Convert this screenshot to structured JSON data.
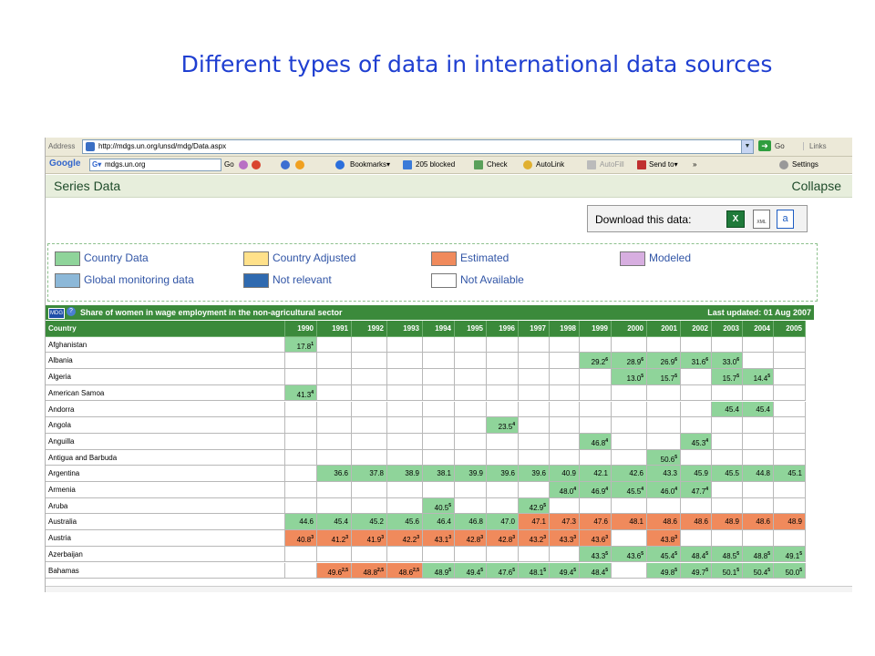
{
  "slide": {
    "title": "Different types of data in international data sources"
  },
  "browser": {
    "address_label": "Address",
    "url": "http://mdgs.un.org/unsd/mdg/Data.aspx",
    "go_label": "Go",
    "links_label": "Links",
    "toolbar": {
      "search_value": "mdgs.un.org",
      "go_label": "Go",
      "bookmarks_label": "Bookmarks▾",
      "blocked_label": "205 blocked",
      "check_label": "Check",
      "autolink_label": "AutoLink",
      "autofill_label": "AutoFill",
      "sendto_label": "Send to▾",
      "more_label": "»",
      "settings_label": "Settings"
    }
  },
  "page": {
    "series_label": "Series Data",
    "collapse_label": "Collapse",
    "download_label": "Download this data:",
    "legend": [
      {
        "label": "Country Data",
        "color": "#8fd49a"
      },
      {
        "label": "Country Adjusted",
        "color": "#ffe18a"
      },
      {
        "label": "Estimated",
        "color": "#f08a5c"
      },
      {
        "label": "Modeled",
        "color": "#d7aee0"
      },
      {
        "label": "Global monitoring data",
        "color": "#8cb8d8"
      },
      {
        "label": "Not relevant",
        "color": "#2f6ab0"
      },
      {
        "label": "Not Available",
        "color": "#ffffff"
      }
    ],
    "table_title": "Share of women in wage employment in the non-agricultural sector",
    "last_updated": "Last updated: 01 Aug 2007",
    "colors": {
      "green": "#8fd49a",
      "orange": "#f08a5c",
      "white": "#ffffff"
    }
  },
  "table": {
    "country_header": "Country",
    "years": [
      "1990",
      "1991",
      "1992",
      "1993",
      "1994",
      "1995",
      "1996",
      "1997",
      "1998",
      "1999",
      "2000",
      "2001",
      "2002",
      "2003",
      "2004",
      "2005"
    ],
    "rows": [
      {
        "country": "Afghanistan",
        "cells": [
          {
            "y": "1990",
            "v": "17.8",
            "fn": "1",
            "c": "g"
          }
        ]
      },
      {
        "country": "Albania",
        "cells": [
          {
            "y": "1999",
            "v": "29.2",
            "fn": "6",
            "c": "g"
          },
          {
            "y": "2000",
            "v": "28.9",
            "fn": "6",
            "c": "g"
          },
          {
            "y": "2001",
            "v": "26.9",
            "fn": "6",
            "c": "g"
          },
          {
            "y": "2002",
            "v": "31.6",
            "fn": "6",
            "c": "g"
          },
          {
            "y": "2003",
            "v": "33.0",
            "fn": "6",
            "c": "g"
          }
        ]
      },
      {
        "country": "Algeria",
        "cells": [
          {
            "y": "2000",
            "v": "13.0",
            "fn": "5",
            "c": "g"
          },
          {
            "y": "2001",
            "v": "15.7",
            "fn": "5",
            "c": "g"
          },
          {
            "y": "2003",
            "v": "15.7",
            "fn": "5",
            "c": "g"
          },
          {
            "y": "2004",
            "v": "14.4",
            "fn": "5",
            "c": "g"
          }
        ]
      },
      {
        "country": "American Samoa",
        "cells": [
          {
            "y": "1990",
            "v": "41.3",
            "fn": "4",
            "c": "g"
          }
        ]
      },
      {
        "country": "Andorra",
        "cells": [
          {
            "y": "2003",
            "v": "45.4",
            "fn": "",
            "c": "g"
          },
          {
            "y": "2004",
            "v": "45.4",
            "fn": "",
            "c": "g"
          }
        ]
      },
      {
        "country": "Angola",
        "cells": [
          {
            "y": "1996",
            "v": "23.5",
            "fn": "4",
            "c": "g"
          }
        ]
      },
      {
        "country": "Anguilla",
        "cells": [
          {
            "y": "1999",
            "v": "46.8",
            "fn": "4",
            "c": "g"
          },
          {
            "y": "2002",
            "v": "45.3",
            "fn": "4",
            "c": "g"
          }
        ]
      },
      {
        "country": "Antigua and Barbuda",
        "cells": [
          {
            "y": "2001",
            "v": "50.6",
            "fn": "5",
            "c": "g"
          }
        ]
      },
      {
        "country": "Argentina",
        "cells": [
          {
            "y": "1991",
            "v": "36.6",
            "fn": "",
            "c": "g"
          },
          {
            "y": "1992",
            "v": "37.8",
            "fn": "",
            "c": "g"
          },
          {
            "y": "1993",
            "v": "38.9",
            "fn": "",
            "c": "g"
          },
          {
            "y": "1994",
            "v": "38.1",
            "fn": "",
            "c": "g"
          },
          {
            "y": "1995",
            "v": "39.9",
            "fn": "",
            "c": "g"
          },
          {
            "y": "1996",
            "v": "39.6",
            "fn": "",
            "c": "g"
          },
          {
            "y": "1997",
            "v": "39.6",
            "fn": "",
            "c": "g"
          },
          {
            "y": "1998",
            "v": "40.9",
            "fn": "",
            "c": "g"
          },
          {
            "y": "1999",
            "v": "42.1",
            "fn": "",
            "c": "g"
          },
          {
            "y": "2000",
            "v": "42.6",
            "fn": "",
            "c": "g"
          },
          {
            "y": "2001",
            "v": "43.3",
            "fn": "",
            "c": "g"
          },
          {
            "y": "2002",
            "v": "45.9",
            "fn": "",
            "c": "g"
          },
          {
            "y": "2003",
            "v": "45.5",
            "fn": "",
            "c": "g"
          },
          {
            "y": "2004",
            "v": "44.8",
            "fn": "",
            "c": "g"
          },
          {
            "y": "2005",
            "v": "45.1",
            "fn": "",
            "c": "g"
          }
        ]
      },
      {
        "country": "Armenia",
        "cells": [
          {
            "y": "1998",
            "v": "48.0",
            "fn": "4",
            "c": "g"
          },
          {
            "y": "1999",
            "v": "46.9",
            "fn": "4",
            "c": "g"
          },
          {
            "y": "2000",
            "v": "45.5",
            "fn": "4",
            "c": "g"
          },
          {
            "y": "2001",
            "v": "46.0",
            "fn": "4",
            "c": "g"
          },
          {
            "y": "2002",
            "v": "47.7",
            "fn": "4",
            "c": "g"
          }
        ]
      },
      {
        "country": "Aruba",
        "cells": [
          {
            "y": "1994",
            "v": "40.5",
            "fn": "5",
            "c": "g"
          },
          {
            "y": "1997",
            "v": "42.9",
            "fn": "5",
            "c": "g"
          }
        ]
      },
      {
        "country": "Australia",
        "cells": [
          {
            "y": "1990",
            "v": "44.6",
            "fn": "",
            "c": "g"
          },
          {
            "y": "1991",
            "v": "45.4",
            "fn": "",
            "c": "g"
          },
          {
            "y": "1992",
            "v": "45.2",
            "fn": "",
            "c": "g"
          },
          {
            "y": "1993",
            "v": "45.6",
            "fn": "",
            "c": "g"
          },
          {
            "y": "1994",
            "v": "46.4",
            "fn": "",
            "c": "g"
          },
          {
            "y": "1995",
            "v": "46.8",
            "fn": "",
            "c": "g"
          },
          {
            "y": "1996",
            "v": "47.0",
            "fn": "",
            "c": "g"
          },
          {
            "y": "1997",
            "v": "47.1",
            "fn": "",
            "c": "o"
          },
          {
            "y": "1998",
            "v": "47.3",
            "fn": "",
            "c": "o"
          },
          {
            "y": "1999",
            "v": "47.6",
            "fn": "",
            "c": "o"
          },
          {
            "y": "2000",
            "v": "48.1",
            "fn": "",
            "c": "o"
          },
          {
            "y": "2001",
            "v": "48.6",
            "fn": "",
            "c": "o"
          },
          {
            "y": "2002",
            "v": "48.6",
            "fn": "",
            "c": "o"
          },
          {
            "y": "2003",
            "v": "48.9",
            "fn": "",
            "c": "o"
          },
          {
            "y": "2004",
            "v": "48.6",
            "fn": "",
            "c": "o"
          },
          {
            "y": "2005",
            "v": "48.9",
            "fn": "",
            "c": "o"
          }
        ]
      },
      {
        "country": "Austria",
        "cells": [
          {
            "y": "1990",
            "v": "40.8",
            "fn": "3",
            "c": "o"
          },
          {
            "y": "1991",
            "v": "41.2",
            "fn": "3",
            "c": "o"
          },
          {
            "y": "1992",
            "v": "41.9",
            "fn": "3",
            "c": "o"
          },
          {
            "y": "1993",
            "v": "42.2",
            "fn": "3",
            "c": "o"
          },
          {
            "y": "1994",
            "v": "43.1",
            "fn": "3",
            "c": "o"
          },
          {
            "y": "1995",
            "v": "42.8",
            "fn": "3",
            "c": "o"
          },
          {
            "y": "1996",
            "v": "42.8",
            "fn": "3",
            "c": "o"
          },
          {
            "y": "1997",
            "v": "43.2",
            "fn": "3",
            "c": "o"
          },
          {
            "y": "1998",
            "v": "43.3",
            "fn": "3",
            "c": "o"
          },
          {
            "y": "1999",
            "v": "43.6",
            "fn": "3",
            "c": "o"
          },
          {
            "y": "2001",
            "v": "43.8",
            "fn": "3",
            "c": "o"
          }
        ]
      },
      {
        "country": "Azerbaijan",
        "cells": [
          {
            "y": "1999",
            "v": "43.3",
            "fn": "5",
            "c": "g"
          },
          {
            "y": "2000",
            "v": "43.6",
            "fn": "5",
            "c": "g"
          },
          {
            "y": "2001",
            "v": "45.4",
            "fn": "5",
            "c": "g"
          },
          {
            "y": "2002",
            "v": "48.4",
            "fn": "5",
            "c": "g"
          },
          {
            "y": "2003",
            "v": "48.5",
            "fn": "5",
            "c": "g"
          },
          {
            "y": "2004",
            "v": "48.8",
            "fn": "5",
            "c": "g"
          },
          {
            "y": "2005",
            "v": "49.1",
            "fn": "5",
            "c": "g"
          }
        ]
      },
      {
        "country": "Bahamas",
        "cells": [
          {
            "y": "1991",
            "v": "49.6",
            "fn": "2,5",
            "c": "o"
          },
          {
            "y": "1992",
            "v": "48.8",
            "fn": "2,5",
            "c": "o"
          },
          {
            "y": "1993",
            "v": "48.6",
            "fn": "2,5",
            "c": "o"
          },
          {
            "y": "1994",
            "v": "48.9",
            "fn": "5",
            "c": "g"
          },
          {
            "y": "1995",
            "v": "49.4",
            "fn": "5",
            "c": "g"
          },
          {
            "y": "1996",
            "v": "47.6",
            "fn": "5",
            "c": "g"
          },
          {
            "y": "1997",
            "v": "48.1",
            "fn": "5",
            "c": "g"
          },
          {
            "y": "1998",
            "v": "49.4",
            "fn": "5",
            "c": "g"
          },
          {
            "y": "1999",
            "v": "48.4",
            "fn": "5",
            "c": "g"
          },
          {
            "y": "2001",
            "v": "49.8",
            "fn": "5",
            "c": "g"
          },
          {
            "y": "2002",
            "v": "49.7",
            "fn": "5",
            "c": "g"
          },
          {
            "y": "2003",
            "v": "50.1",
            "fn": "5",
            "c": "g"
          },
          {
            "y": "2004",
            "v": "50.4",
            "fn": "5",
            "c": "g"
          },
          {
            "y": "2005",
            "v": "50.0",
            "fn": "5",
            "c": "g"
          }
        ]
      }
    ]
  }
}
